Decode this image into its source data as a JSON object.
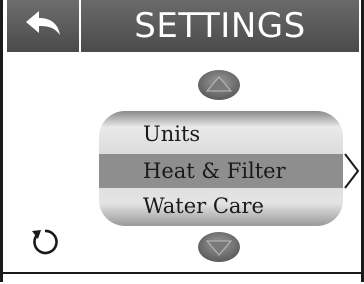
{
  "header": {
    "title": "SETTINGS",
    "back_icon": "back-arrow-icon"
  },
  "menu": {
    "items": [
      {
        "label": "Units"
      },
      {
        "label": "Heat & Filter",
        "selected": true
      },
      {
        "label": "Water Care"
      }
    ]
  },
  "controls": {
    "scroll_up_icon": "up-arrow-icon",
    "scroll_down_icon": "down-arrow-icon",
    "reset_icon": "refresh-icon",
    "selected_indicator_icon": "chevron-right-icon"
  },
  "colors": {
    "header_bg": "#555555",
    "selected_row": "#8e8e8e",
    "menu_bg": "#dddddd",
    "text": "#1a1a1a"
  }
}
